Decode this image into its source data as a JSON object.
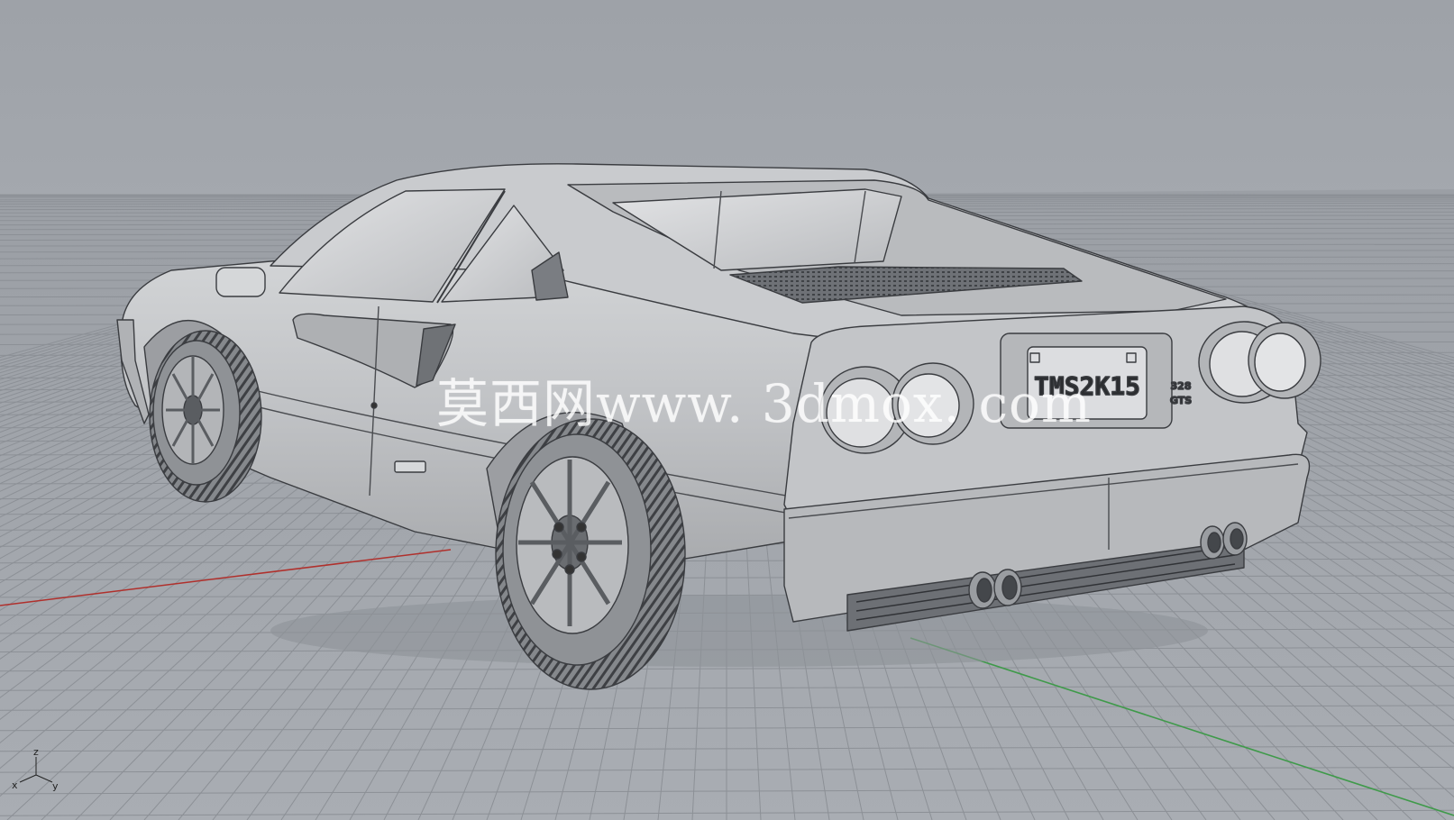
{
  "viewport": {
    "watermark": "莫西网www. 3dmox. com",
    "license_plate": "TMS2K15",
    "badge_line1": "328",
    "badge_line2": "GTS",
    "axis_labels": {
      "z": "z",
      "x": "x",
      "y": "y"
    },
    "colors": {
      "background": "#9fa3a9",
      "grid": "#8c9096",
      "x_axis": "#b0302c",
      "y_axis": "#3f9a4a",
      "model": "#c6c8cb"
    }
  }
}
